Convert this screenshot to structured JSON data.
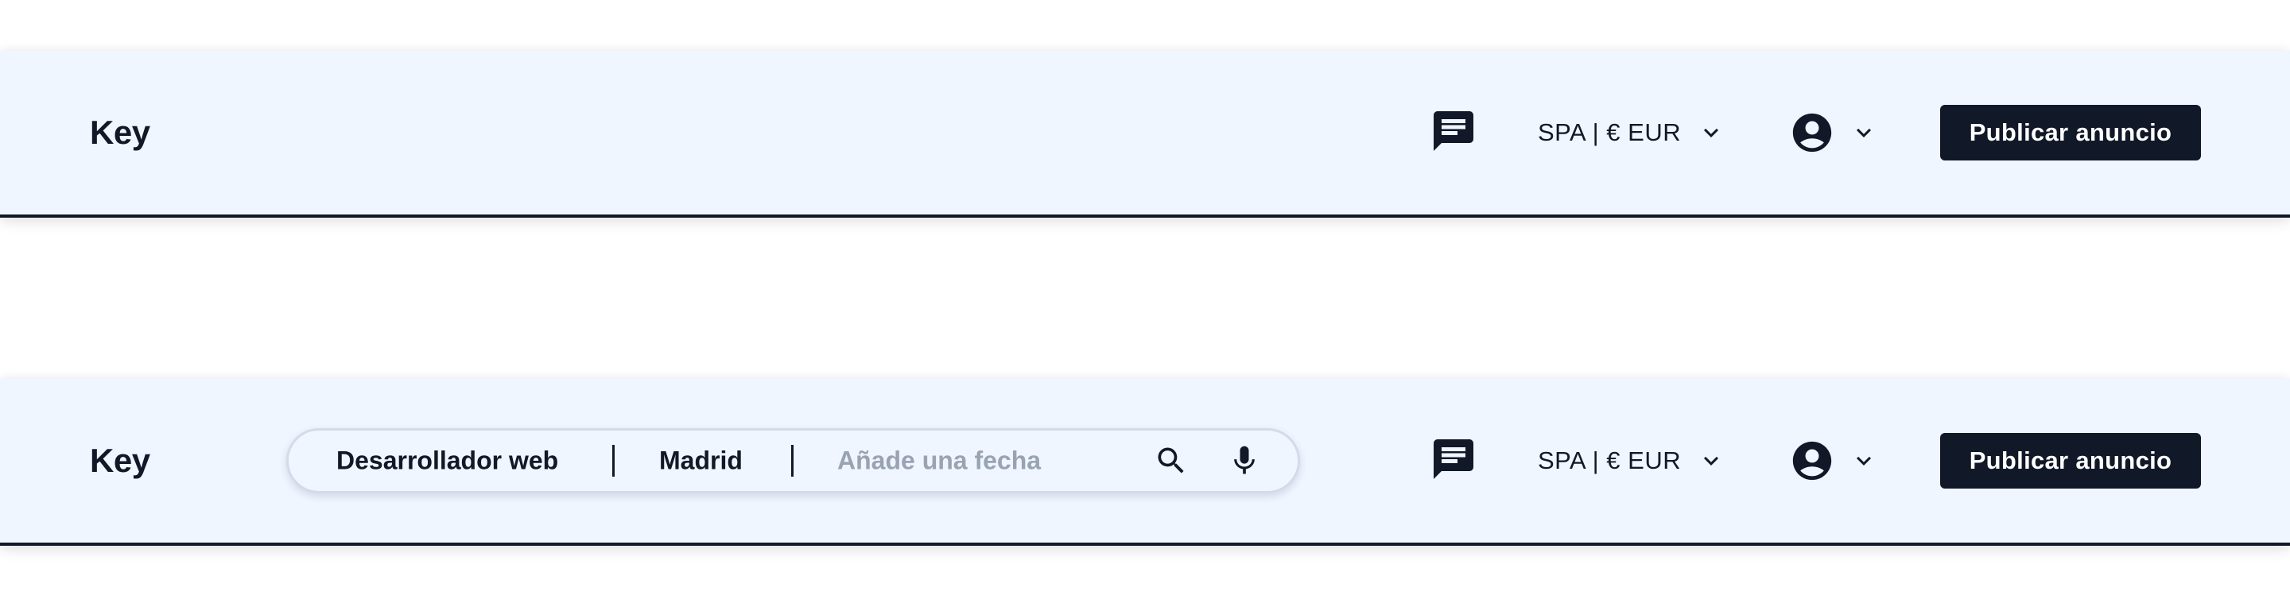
{
  "colors": {
    "navbar_bg": "#eff6ff",
    "text_dark": "#111827",
    "button_bg": "#111827",
    "button_text": "#ffffff",
    "placeholder": "#9aa3b2"
  },
  "navbar_plain": {
    "logo": "Key",
    "chat_icon": "chat-icon",
    "language_currency": "SPA | € EUR",
    "language_chevron_icon": "chevron-down-icon",
    "account_icon": "account-circle-icon",
    "account_chevron_icon": "chevron-down-icon",
    "publish_label": "Publicar anuncio"
  },
  "navbar_search": {
    "logo": "Key",
    "search": {
      "role_value": "Desarrollador web",
      "city_value": "Madrid",
      "date_placeholder": "Añade una fecha",
      "search_icon": "search-icon",
      "mic_icon": "microphone-icon"
    },
    "chat_icon": "chat-icon",
    "language_currency": "SPA | € EUR",
    "language_chevron_icon": "chevron-down-icon",
    "account_icon": "account-circle-icon",
    "account_chevron_icon": "chevron-down-icon",
    "publish_label": "Publicar anuncio"
  }
}
